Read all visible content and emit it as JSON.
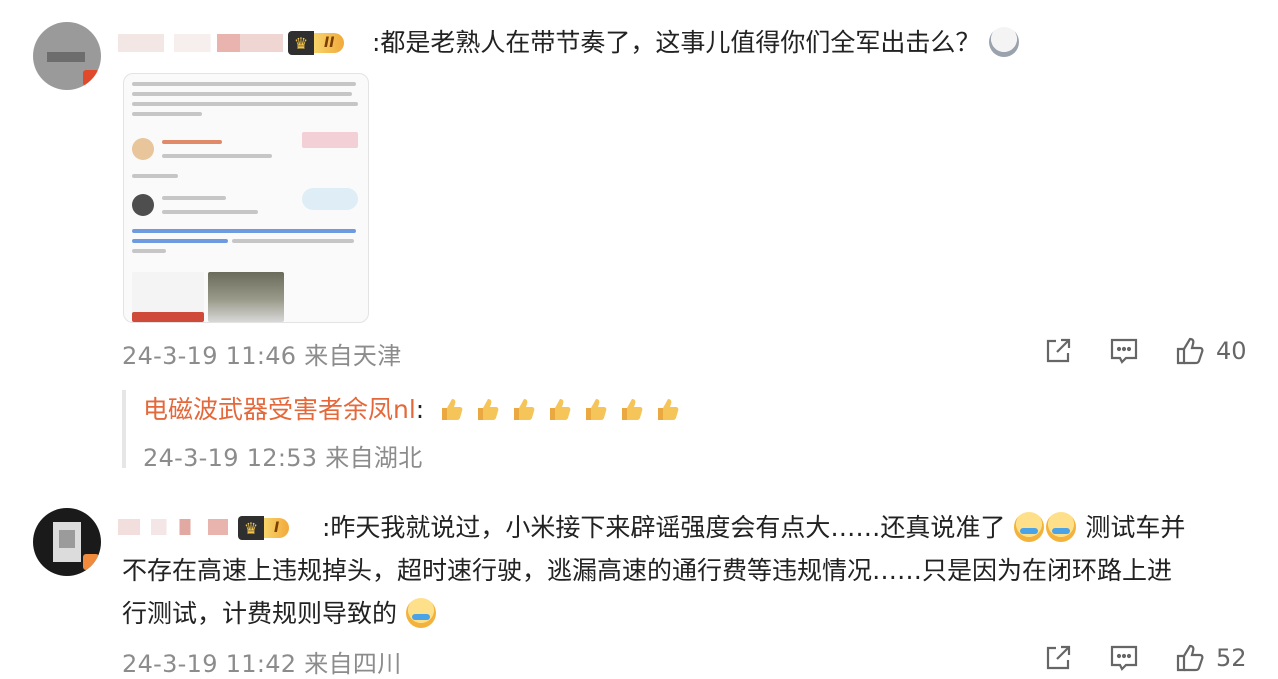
{
  "comments": [
    {
      "medal_level": "II",
      "text": ":都是老熟人在带节奏了，这事儿值得你们全军出击么？",
      "emoji": "ghost-face-emoji",
      "meta": "24-3-19 11:46 来自天津",
      "share_icon": "share-icon",
      "comment_icon": "comment-icon",
      "like_icon": "thumbs-up-icon",
      "likes": "40"
    },
    {
      "medal_level": "I",
      "text_line1": ":昨天我就说过，小米接下来辟谣强度会有点大……还真说准了",
      "text_line1_tail": " 测试车并",
      "text_line2": "不存在高速上违规掉头，超时速行驶，逃漏高速的通行费等违规情况……只是因为在闭环路上进",
      "text_line3": "行测试，计费规则导致的",
      "meta": "24-3-19 11:42 来自四川",
      "likes": "52"
    }
  ],
  "reply": {
    "author": "电磁波武器受害者余凤nl",
    "separator": ":",
    "emoji": "thumbs-up-emoji",
    "emoji_count": 7,
    "meta": "24-3-19 12:53 来自湖北"
  },
  "colors": {
    "reply_name": "#e4683a",
    "meta": "#8c8c8c",
    "medal_gold": "#f5c64a"
  }
}
